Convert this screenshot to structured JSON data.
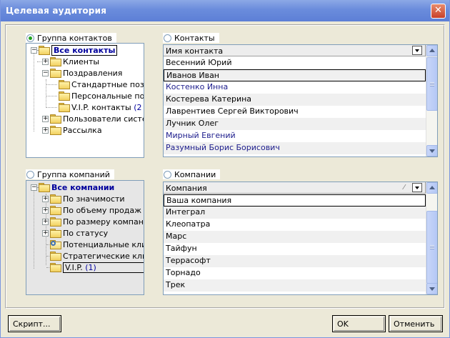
{
  "window": {
    "title": "Целевая аудитория",
    "close_glyph": "✕"
  },
  "contact_group": {
    "radio_label": "Группа контактов",
    "checked": true,
    "tree": {
      "root": "Все контакты",
      "clients": "Клиенты",
      "greetings": "Поздравления",
      "standard": "Стандартные позд",
      "personal": "Персональные поз,",
      "vip": "V.I.P. контакты",
      "vip_count": "(2",
      "system_users": "Пользователи системы",
      "mailing": "Рассылка"
    }
  },
  "contacts": {
    "radio_label": "Контакты",
    "checked": false,
    "header": "Имя контакта",
    "rows": [
      "Весенний Юрий",
      "Иванов Иван",
      "Костенко Инна",
      "Костерева Катерина",
      "Лаврентиев Сергей Викторович",
      "Лучник Олег",
      "Мирный Евгений",
      "Разумный Борис Борисович"
    ]
  },
  "company_group": {
    "radio_label": "Группа компаний",
    "checked": false,
    "tree": {
      "root": "Все компании",
      "by_significance": "По значимости",
      "by_sales": "По объему продаж",
      "by_size": "По размеру компании",
      "by_status": "По статусу",
      "potential": "Потенциальные клиен",
      "strategic": "Стратегические клиен",
      "vip": "V.I.P.",
      "vip_count": "(1)"
    }
  },
  "companies": {
    "radio_label": "Компании",
    "checked": false,
    "header": "Компания",
    "sort_mark": "⁄",
    "rows": [
      "Ваша компания",
      "Интеграл",
      "Клеопатра",
      "Марс",
      "Тайфун",
      "Террасофт",
      "Торнадо",
      "Трек"
    ]
  },
  "buttons": {
    "script": "Скрипт...",
    "ok": "OK",
    "cancel": "Отменить"
  },
  "colors": {
    "title_bar": "#6A8CDC",
    "blue_text": "#1C1C8C",
    "radio_check": "#21A121"
  }
}
